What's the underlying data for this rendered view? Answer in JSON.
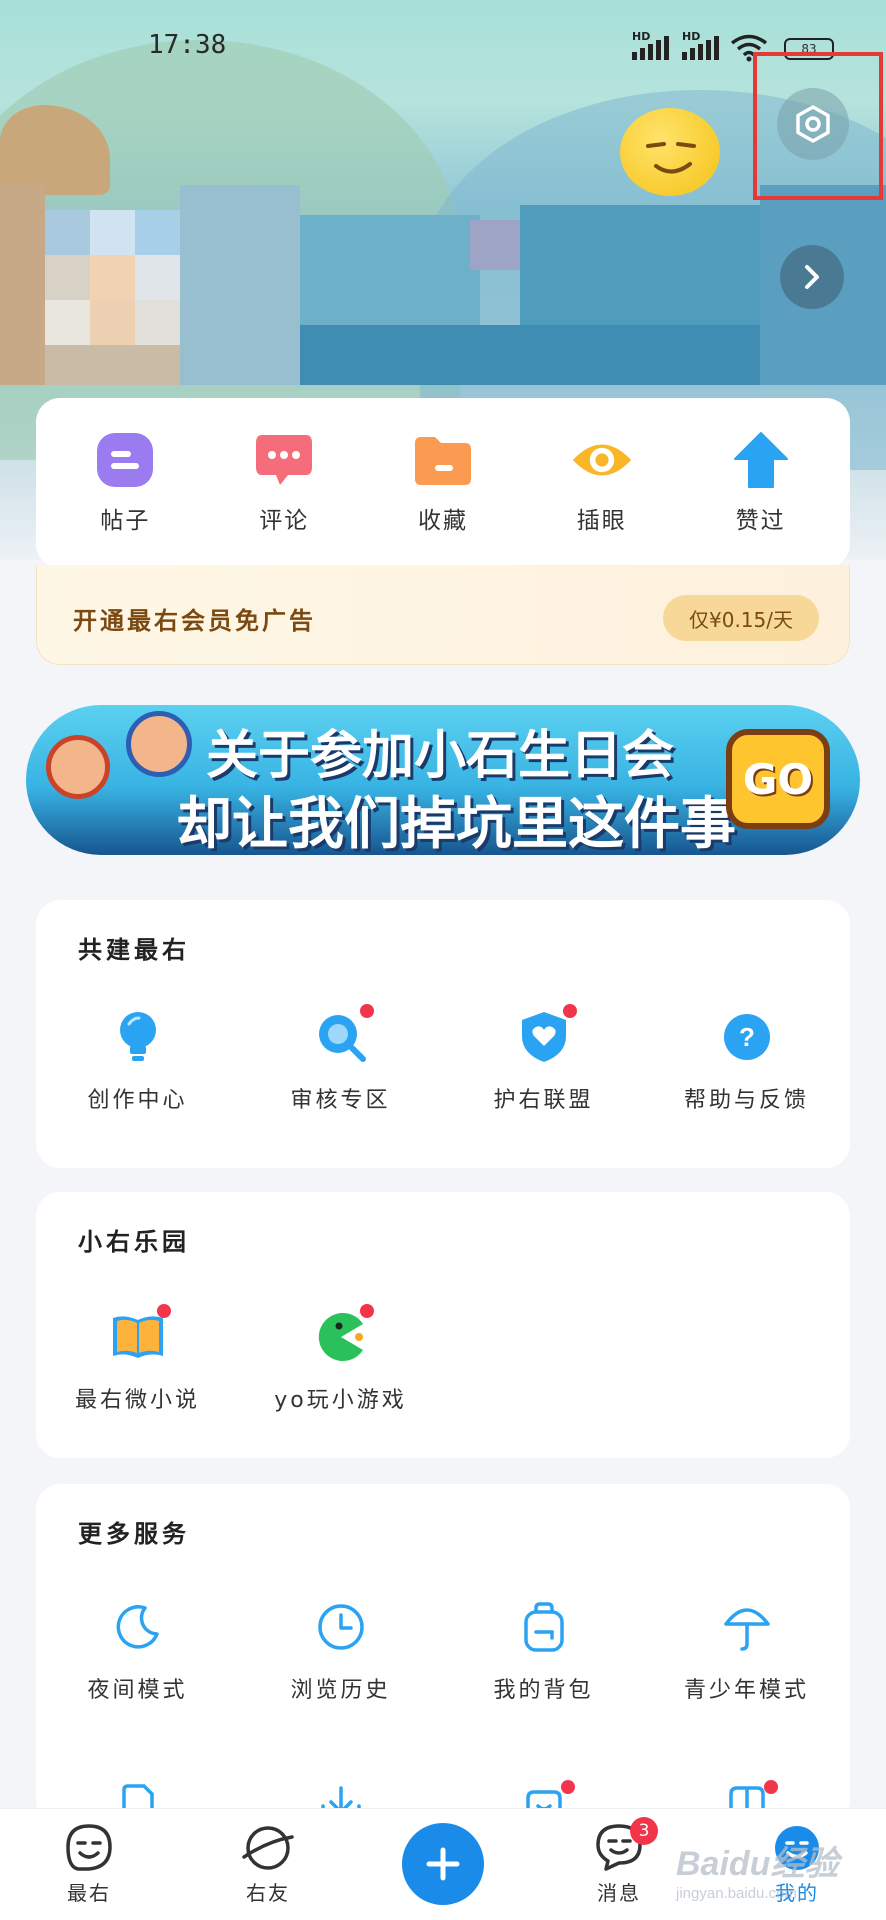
{
  "status_bar": {
    "time": "17:38",
    "signal1": "HD",
    "signal2": "HD",
    "battery": "83"
  },
  "quick_actions": [
    {
      "label": "帖子",
      "icon": "post-icon"
    },
    {
      "label": "评论",
      "icon": "comment-icon"
    },
    {
      "label": "收藏",
      "icon": "folder-icon"
    },
    {
      "label": "插眼",
      "icon": "eye-icon"
    },
    {
      "label": "赞过",
      "icon": "thumb-up-icon"
    }
  ],
  "vip": {
    "text": "开通最右会员免广告",
    "price": "仅¥0.15/天"
  },
  "banner": {
    "line1": "关于参加小石生日会",
    "line2": "却让我们掉坑里这件事",
    "go": "GO"
  },
  "section_build": {
    "title": "共建最右",
    "items": [
      {
        "label": "创作中心",
        "icon": "bulb-icon"
      },
      {
        "label": "审核专区",
        "icon": "magnifier-icon"
      },
      {
        "label": "护右联盟",
        "icon": "shield-heart-icon"
      },
      {
        "label": "帮助与反馈",
        "icon": "help-icon"
      }
    ]
  },
  "section_park": {
    "title": "小右乐园",
    "items": [
      {
        "label": "最右微小说",
        "icon": "book-icon"
      },
      {
        "label": "yo玩小游戏",
        "icon": "game-icon"
      }
    ]
  },
  "section_more": {
    "title": "更多服务",
    "items": [
      {
        "label": "夜间模式",
        "icon": "moon-icon"
      },
      {
        "label": "浏览历史",
        "icon": "clock-icon"
      },
      {
        "label": "我的背包",
        "icon": "backpack-icon"
      },
      {
        "label": "青少年模式",
        "icon": "umbrella-icon"
      }
    ]
  },
  "bottom_nav": {
    "home": "最右",
    "friends": "右友",
    "messages": "消息",
    "messages_badge": "3",
    "mine": "我的"
  },
  "watermark": {
    "brand": "Baidu经验",
    "domain": "jingyan.baidu.com"
  },
  "colors": {
    "accent": "#1a8be8",
    "badge": "#f2354a",
    "highlight": "#e53935"
  }
}
